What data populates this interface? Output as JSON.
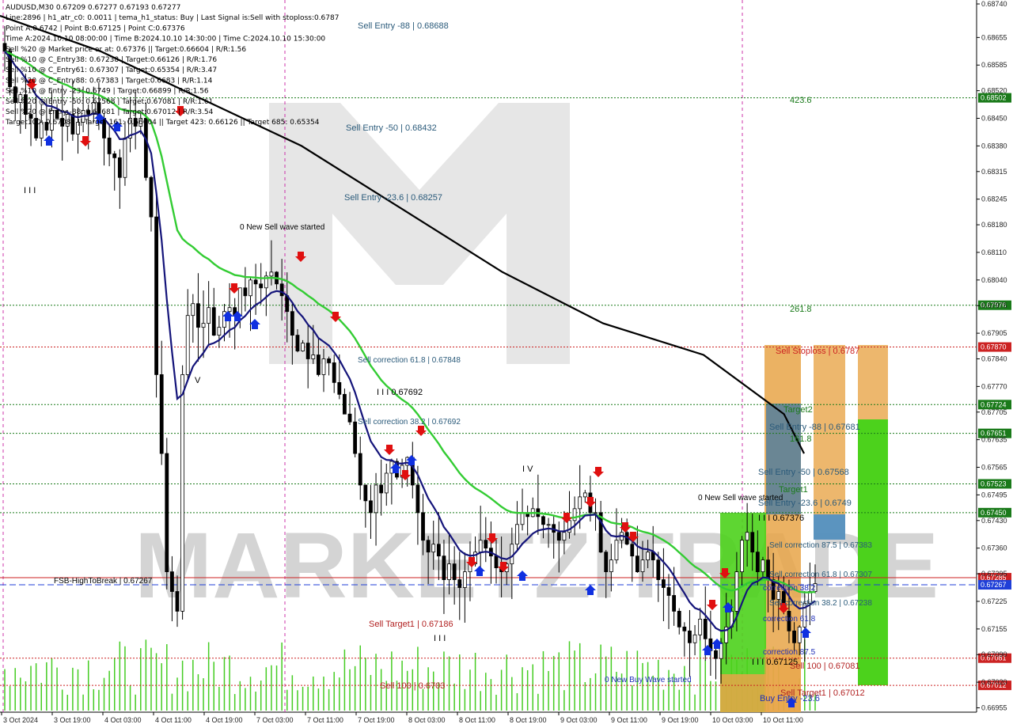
{
  "info_panel": {
    "lines": [
      "AUDUSD,M30  0.67209 0.67277 0.67193 0.67277",
      "Line:2896 | h1_atr_c0: 0.0011 | tema_h1_status: Buy | Last Signal is:Sell with stoploss:0.6787",
      "Point A:0.6742 | Point B:0.67125 | Point C:0.67376",
      "Time A:2024.10.10 08:00:00 | Time B:2024.10.10 14:30:00 | Time C:2024.10.10 15:30:00",
      "Sell %20 @ Market price or at: 0.67376 || Target:0.66604 | R/R:1.56",
      "Sell %10 @ C_Entry38: 0.67238 | Target:0.66126 | R/R:1.76",
      "Sell %10 @ C_Entry61: 0.67307 | Target:0.65354 | R/R:3.47",
      "Sell %20 @ C_Entry88: 0.67383 | Target:0.6683 | R/R:1.14",
      "Sell %10 @ Entry -23: 0.6749 | Target:0.66899 | R/R:1.56",
      "Sell %20 @ Entry -50: 0.67568 | Target:0.67081 | R/R:1.61",
      "Sell %20 @ Entry -88: 0.67681 | Target:0.67012 | R/R:3.54",
      "Target100: 0.67081 || Target 161: 0.66604 || Target 423: 0.66126 || Target 685: 0.65354"
    ]
  },
  "watermark": {
    "text": "MARKETZITRADE",
    "color": "#c8c8c8"
  },
  "chart_data": {
    "type": "candlestick",
    "symbol": "AUDUSD",
    "timeframe": "M30",
    "ylim": [
      0.6695,
      0.6874
    ],
    "y_ticks": [
      "0.68740",
      "0.68655",
      "0.68585",
      "0.68520",
      "0.68450",
      "0.68380",
      "0.68315",
      "0.68245",
      "0.68180",
      "0.68110",
      "0.68040",
      "0.67975",
      "0.67905",
      "0.67840",
      "0.67770",
      "0.67705",
      "0.67635",
      "0.67565",
      "0.67495",
      "0.67430",
      "0.67360",
      "0.67295",
      "0.67225",
      "0.67155",
      "0.67090",
      "0.67020",
      "0.66955"
    ],
    "x_ticks": [
      "3 Oct 2024",
      "3 Oct 19:00",
      "4 Oct 03:00",
      "4 Oct 11:00",
      "4 Oct 19:00",
      "7 Oct 03:00",
      "7 Oct 11:00",
      "7 Oct 19:00",
      "8 Oct 03:00",
      "8 Oct 11:00",
      "8 Oct 19:00",
      "9 Oct 03:00",
      "9 Oct 11:00",
      "9 Oct 19:00",
      "10 Oct 03:00",
      "10 Oct 11:00"
    ],
    "current_price": 0.67267,
    "close_series": [
      0.6862,
      0.6853,
      0.6849,
      0.6851,
      0.6846,
      0.6845,
      0.684,
      0.6844,
      0.6842,
      0.6847,
      0.6845,
      0.6843,
      0.6846,
      0.6841,
      0.6844,
      0.6847,
      0.6846,
      0.6849,
      0.6845,
      0.684,
      0.6836,
      0.6835,
      0.683,
      0.684,
      0.6845,
      0.6843,
      0.6845,
      0.683,
      0.682,
      0.678,
      0.676,
      0.673,
      0.6725,
      0.672,
      0.678,
      0.6795,
      0.6798,
      0.6792,
      0.6793,
      0.6797,
      0.679,
      0.6792,
      0.6796,
      0.6797,
      0.6795,
      0.6802,
      0.68,
      0.6804,
      0.6803,
      0.6802,
      0.6805,
      0.6806,
      0.6803,
      0.68,
      0.6796,
      0.679,
      0.6786,
      0.6788,
      0.6784,
      0.6785,
      0.678,
      0.6784,
      0.6783,
      0.6778,
      0.6775,
      0.677,
      0.6768,
      0.676,
      0.6752,
      0.6748,
      0.6745,
      0.6752,
      0.675,
      0.6755,
      0.6758,
      0.6754,
      0.6757,
      0.6759,
      0.6752,
      0.6745,
      0.6738,
      0.6735,
      0.6737,
      0.6734,
      0.6728,
      0.6732,
      0.6728,
      0.6726,
      0.673,
      0.6732,
      0.6735,
      0.6738,
      0.6736,
      0.6734,
      0.6731,
      0.673,
      0.6732,
      0.6737,
      0.6742,
      0.6745,
      0.6744,
      0.6746,
      0.6744,
      0.6742,
      0.6742,
      0.674,
      0.6738,
      0.674,
      0.6743,
      0.6746,
      0.6749,
      0.675,
      0.6745,
      0.6745,
      0.6735,
      0.673,
      0.6733,
      0.6738,
      0.674,
      0.6737,
      0.6734,
      0.673,
      0.6733,
      0.6735,
      0.6733,
      0.6728,
      0.6726,
      0.6724,
      0.672,
      0.6716,
      0.6715,
      0.6712,
      0.6714,
      0.6718,
      0.6713,
      0.671,
      0.6708,
      0.6712,
      0.6716,
      0.672,
      0.673,
      0.6738,
      0.674,
      0.6735,
      0.673,
      0.6733,
      0.6728,
      0.6723,
      0.6725,
      0.672,
      0.6715,
      0.6712,
      0.6716,
      0.6722,
      0.6725,
      0.6727
    ],
    "ma_black": [
      [
        0,
        0.6871
      ],
      [
        0.1,
        0.6862
      ],
      [
        0.2,
        0.685
      ],
      [
        0.3,
        0.6838
      ],
      [
        0.4,
        0.6822
      ],
      [
        0.5,
        0.6806
      ],
      [
        0.6,
        0.6793
      ],
      [
        0.7,
        0.6785
      ],
      [
        0.78,
        0.677
      ],
      [
        0.8,
        0.676
      ]
    ],
    "y_levels": [
      {
        "name": "level-68502",
        "price": 0.68502,
        "label": "0.68502",
        "color": "#1a7a1a",
        "style": "dotted"
      },
      {
        "name": "level-67976",
        "price": 0.67976,
        "label": "0.67976",
        "color": "#1a7a1a",
        "style": "dotted"
      },
      {
        "name": "level-67870",
        "price": 0.6787,
        "label": "0.67870",
        "color": "#cc2222",
        "style": "dotted"
      },
      {
        "name": "level-67724",
        "price": 0.67724,
        "label": "0.67724",
        "color": "#1a7a1a",
        "style": "dotted"
      },
      {
        "name": "level-67651",
        "price": 0.67651,
        "label": "0.67651",
        "color": "#1a7a1a",
        "style": "dotted"
      },
      {
        "name": "level-67523",
        "price": 0.67523,
        "label": "0.67523",
        "color": "#1a7a1a",
        "style": "dotted"
      },
      {
        "name": "level-67450",
        "price": 0.6745,
        "label": "0.67450",
        "color": "#1a7a1a",
        "style": "dotted"
      },
      {
        "name": "level-67285",
        "price": 0.67285,
        "label": "0.67285",
        "color": "#cc2222",
        "style": "solid"
      },
      {
        "name": "level-67267",
        "price": 0.67267,
        "label": "0.67267",
        "color": "#1f3fd8",
        "style": "dashed"
      },
      {
        "name": "level-67081",
        "price": 0.67081,
        "label": "0.67081",
        "color": "#cc2222",
        "style": "dotted"
      },
      {
        "name": "level-67012",
        "price": 0.67012,
        "label": "0.67012",
        "color": "#cc2222",
        "style": "dotted"
      }
    ],
    "annotations": [
      {
        "name": "sell-entry-88-upper",
        "text": "Sell Entry -88 | 0.68688",
        "color": "#2a5a7a"
      },
      {
        "name": "sell-entry-50-upper",
        "text": "Sell Entry -50 | 0.68432",
        "color": "#2a5a7a"
      },
      {
        "name": "sell-entry-23-upper",
        "text": "Sell Entry -23.6 | 0.68257",
        "color": "#2a5a7a"
      },
      {
        "name": "fib-423",
        "text": "423.6",
        "color": "#1a7a1a"
      },
      {
        "name": "new-sell-wave",
        "text": "0 New Sell wave started",
        "color": "#000000"
      },
      {
        "name": "fib-261",
        "text": "261.8",
        "color": "#1a7a1a"
      },
      {
        "name": "sell-correction-61-upper",
        "text": "Sell correction 61.8 | 0.67848",
        "color": "#2a5a7a"
      },
      {
        "name": "wave-label-iii",
        "text": "I I I 0.67692",
        "color": "#000000"
      },
      {
        "name": "sell-correction-38-upper",
        "text": "Sell correction 38.2 | 0.67692",
        "color": "#2a5a7a"
      },
      {
        "name": "wave-label-iv",
        "text": "I V",
        "color": "#000000"
      },
      {
        "name": "wave-label-v",
        "text": "V",
        "color": "#000000"
      },
      {
        "name": "wave-label-i",
        "text": "I I I",
        "color": "#000000"
      },
      {
        "name": "fsb-high-to-break",
        "text": "FSB-HighToBreak | 0.67267",
        "color": "#000000"
      },
      {
        "name": "sell-target1-lower",
        "text": "Sell Target1 | 0.67186",
        "color": "#b22222"
      },
      {
        "name": "wave-label-iii-lower",
        "text": "I I I",
        "color": "#000000"
      },
      {
        "name": "sell-100-lower",
        "text": "Sell 100 | 0.6703",
        "color": "#b22222"
      },
      {
        "name": "new-buy-wave",
        "text": "0 New Buy Wave started",
        "color": "#1f2fb8"
      },
      {
        "name": "sell-stoploss",
        "text": "Sell Stoploss | 0.6787",
        "color": "#cc2222"
      },
      {
        "name": "target2",
        "text": "Target2",
        "color": "#1a7a1a"
      },
      {
        "name": "sell-entry-88-right",
        "text": "Sell Entry -88 | 0.67681",
        "color": "#2a5a7a"
      },
      {
        "name": "fib-161",
        "text": "161.8",
        "color": "#1a7a1a"
      },
      {
        "name": "sell-entry-50-right",
        "text": "Sell Entry -50 | 0.67568",
        "color": "#2a5a7a"
      },
      {
        "name": "target1",
        "text": "Target1",
        "color": "#1a7a1a"
      },
      {
        "name": "new-sell-wave-right",
        "text": "0 New Sell wave started",
        "color": "#000000"
      },
      {
        "name": "sell-entry-23-right",
        "text": "Sell Entry -23.6 | 0.6749",
        "color": "#2a5a7a"
      },
      {
        "name": "wave-iii-right",
        "text": "I I I 0.67376",
        "color": "#000000"
      },
      {
        "name": "sell-correction-87-right",
        "text": "Sell correction 87.5 | 0.67383",
        "color": "#2a5a7a"
      },
      {
        "name": "sell-correction-61-right",
        "text": "Sell correction 61.8 | 0.67307",
        "color": "#2a5a7a"
      },
      {
        "name": "correction-38-right",
        "text": "correction 38.2",
        "color": "#1f2fb8"
      },
      {
        "name": "sell-correction-38-right",
        "text": "Sell correction 38.2 | 0.67238",
        "color": "#2a5a7a"
      },
      {
        "name": "correction-61-right",
        "text": "correction 61.8",
        "color": "#1f2fb8"
      },
      {
        "name": "correction-87-right",
        "text": "correction 87.5",
        "color": "#1f2fb8"
      },
      {
        "name": "wave-iii-0671",
        "text": "I I I 0.67125",
        "color": "#000000"
      },
      {
        "name": "sell-100-right",
        "text": "Sell 100 | 0.67081",
        "color": "#b22222"
      },
      {
        "name": "sell-target1-right",
        "text": "Sell Target1 | 0.67012",
        "color": "#b22222"
      },
      {
        "name": "buy-entry-23",
        "text": "Buy Entry -23.6",
        "color": "#1f2fb8"
      }
    ]
  }
}
